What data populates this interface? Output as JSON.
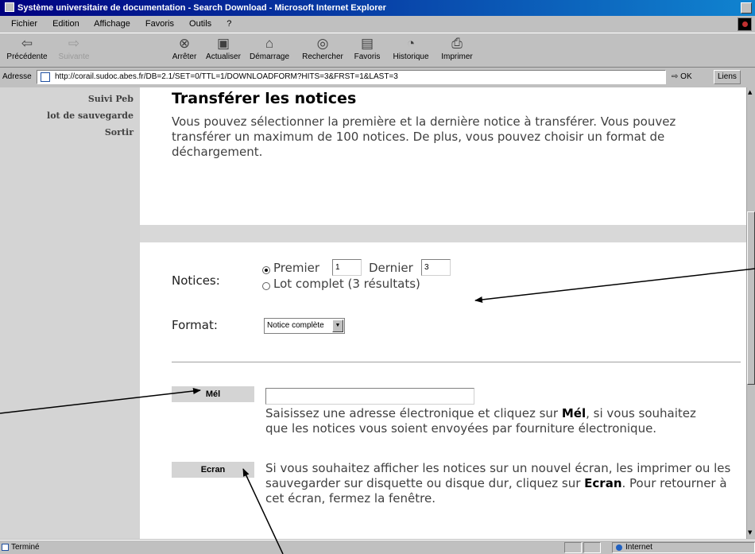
{
  "window": {
    "title": "Système universitaire de documentation - Search Download - Microsoft Internet Explorer"
  },
  "menubar": {
    "items": [
      "Fichier",
      "Edition",
      "Affichage",
      "Favoris",
      "Outils",
      "?"
    ]
  },
  "toolbar": {
    "buttons": [
      {
        "label": "Précédente",
        "icon": "back-arrow-icon"
      },
      {
        "label": "Suivante",
        "icon": "forward-arrow-icon"
      },
      {
        "label": "Arrêter",
        "icon": "stop-icon"
      },
      {
        "label": "Actualiser",
        "icon": "refresh-icon"
      },
      {
        "label": "Démarrage",
        "icon": "home-icon"
      },
      {
        "label": "Rechercher",
        "icon": "search-icon"
      },
      {
        "label": "Favoris",
        "icon": "favorites-icon"
      },
      {
        "label": "Historique",
        "icon": "history-icon"
      },
      {
        "label": "Imprimer",
        "icon": "print-icon"
      }
    ]
  },
  "address": {
    "label": "Adresse",
    "url": "http://corail.sudoc.abes.fr/DB=2.1/SET=0/TTL=1/DOWNLOADFORM?HITS=3&FRST=1&LAST=3",
    "go_label": "OK",
    "links_label": "Liens"
  },
  "leftnav": {
    "items": [
      "Suivi Peb",
      "lot de sauvegarde",
      "Sortir"
    ]
  },
  "page": {
    "heading": "Transférer les notices",
    "intro": "Vous pouvez sélectionner la première et la dernière notice à transférer. Vous pouvez transférer un maximum de 100 notices. De plus, vous pouvez choisir un format de déchargement.",
    "notices_label": "Notices:",
    "premier_label": "Premier",
    "premier_value": "1",
    "dernier_label": "Dernier",
    "dernier_value": "3",
    "lot_complet_label": "Lot complet (3 résultats)",
    "format_label": "Format:",
    "format_selected": "Notice complète",
    "mel_button": "Mél",
    "mel_value": "",
    "mel_text_before": "Saisissez une adresse électronique et cliquez sur ",
    "mel_text_bold": "Mél",
    "mel_text_after": ", si vous souhaitez que les notices vous soient envoyées par fourniture électronique.",
    "ecran_button": "Ecran",
    "ecran_text_before": "Si vous souhaitez afficher les notices sur un nouvel écran, les imprimer ou les sauvegarder sur disquette ou disque dur, cliquez sur ",
    "ecran_text_bold": "Ecran",
    "ecran_text_after": ". Pour retourner à cet écran, fermez la fenêtre."
  },
  "statusbar": {
    "text": "Terminé",
    "zone": "Internet"
  }
}
